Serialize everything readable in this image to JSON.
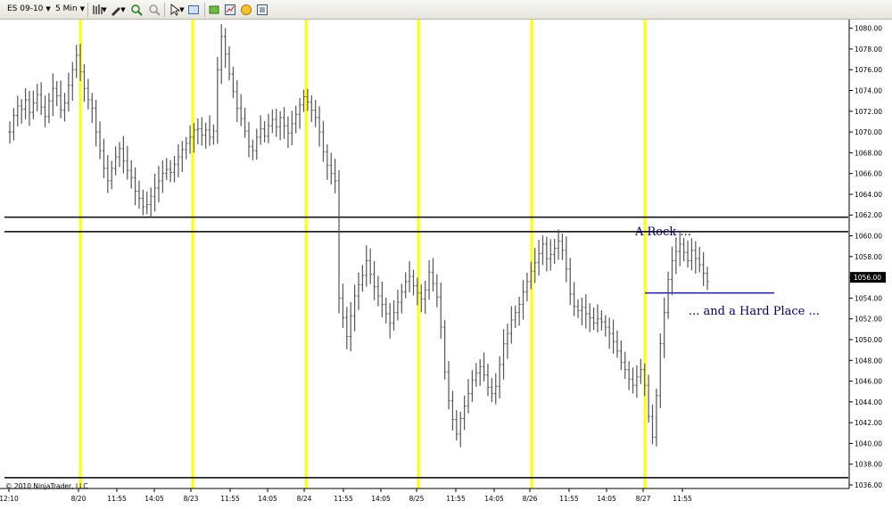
{
  "toolbar": {
    "instrument": "ES 09-10",
    "interval": "5 Min"
  },
  "copyright": "© 2010 NinjaTrader, LLC",
  "colors": {
    "price": "#555555",
    "session_divider": "#ffff00",
    "level_line": "#000000",
    "support_line": "#1a1aa0",
    "annotation": "#000060"
  },
  "chart_data": {
    "type": "bar",
    "subtype": "ohlc-price-bars",
    "instrument": "ES 09-10",
    "interval": "5 Min",
    "ylim": [
      1036,
      1081
    ],
    "y_ticks": [
      1036,
      1038,
      1040,
      1042,
      1044,
      1046,
      1048,
      1050,
      1052,
      1054,
      1056,
      1058,
      1060,
      1062,
      1064,
      1066,
      1068,
      1070,
      1072,
      1074,
      1076,
      1078,
      1080
    ],
    "y_tick_labels": [
      "1036.00",
      "1038.00",
      "1040.00",
      "1042.00",
      "1044.00",
      "1046.00",
      "1048.00",
      "1050.00",
      "1052.00",
      "1054.00",
      "1056.00",
      "1058.00",
      "1060.00",
      "1062.00",
      "1064.00",
      "1066.00",
      "1068.00",
      "1070.00",
      "1072.00",
      "1074.00",
      "1076.00",
      "1078.00",
      "1080.00"
    ],
    "x_tick_labels": [
      "12:10",
      "8/20",
      "11:55",
      "14:05",
      "8/23",
      "11:55",
      "14:05",
      "8/24",
      "11:55",
      "14:05",
      "8/25",
      "11:55",
      "14:05",
      "8/26",
      "11:55",
      "14:05",
      "8/27",
      "11:55"
    ],
    "sessions": [
      "8/20",
      "8/23",
      "8/24",
      "8/25",
      "8/26",
      "8/27"
    ],
    "current_price": "1056.00",
    "horizontal_levels": [
      {
        "value": 1061.8,
        "color": "black"
      },
      {
        "value": 1060.4,
        "color": "black"
      },
      {
        "value": 1036.7,
        "color": "black"
      },
      {
        "value": 1054.5,
        "color": "blue",
        "start": "8/27"
      }
    ],
    "annotations": [
      "A Rock ...",
      "... and a Hard Place ..."
    ],
    "series": [
      {
        "values": [
          1070,
          1071.6,
          1072.5,
          1072.2,
          1073.1,
          1071.9,
          1072.8,
          1073.6,
          1072.4,
          1071.5,
          1073,
          1074.2,
          1073.5,
          1072.1,
          1072.8,
          1074.5,
          1076,
          1077.4,
          1075.8,
          1074.2,
          1073.1,
          1072.3,
          1070,
          1068.2,
          1066.5,
          1065.3,
          1066.5,
          1067.6,
          1068.4,
          1067.2,
          1066.3,
          1065.6,
          1064.3,
          1063.6,
          1062.8,
          1063,
          1063.8,
          1064.6,
          1065.3,
          1066,
          1066.4,
          1066.1,
          1066.9,
          1067.6,
          1068.3,
          1068.9,
          1069.5,
          1070.2,
          1070.3,
          1069.7,
          1070.2,
          1069.5,
          1070.1,
          1076,
          1079.2,
          1077.5,
          1075.6,
          1073.9,
          1072.3,
          1071.3,
          1070.1,
          1068.6,
          1068.2,
          1069.5,
          1070.3,
          1069.6,
          1070.6,
          1071.2,
          1070.5,
          1071.4,
          1070.6,
          1069.9,
          1070.8,
          1071.7,
          1072.6,
          1073.4,
          1072.9,
          1072.1,
          1071.4,
          1070,
          1068.1,
          1066.8,
          1066,
          1065.3,
          1054,
          1052.1,
          1050.3,
          1052.3,
          1054.2,
          1055.3,
          1056.2,
          1057.6,
          1056.3,
          1055.1,
          1054.2,
          1053.4,
          1052.5,
          1051.6,
          1052.6,
          1053.6,
          1054.6,
          1055.6,
          1056.1,
          1055.2,
          1054.5,
          1053.9,
          1054.8,
          1056.5,
          1055.4,
          1054.1,
          1051.2,
          1046.9,
          1044.1,
          1042.3,
          1040.9,
          1042.4,
          1043.6,
          1044.8,
          1046.1,
          1046.8,
          1047.4,
          1046.6,
          1045.4,
          1044.8,
          1045.5,
          1047.6,
          1049.6,
          1050.6,
          1051.9,
          1052.6,
          1053.4,
          1054.6,
          1055.6,
          1056.6,
          1057.4,
          1058.3,
          1059.2,
          1057.8,
          1058.2,
          1058.8,
          1059.5,
          1058.6,
          1056.8,
          1054.4,
          1053.2,
          1052.8,
          1053.1,
          1052.5,
          1052.1,
          1051.6,
          1052,
          1051.7,
          1051.2,
          1050.6,
          1049.8,
          1048.9,
          1047.8,
          1047.1,
          1046.2,
          1045.6,
          1046.4,
          1047.1,
          1045.6,
          1042.6,
          1040.6,
          1044.6,
          1049.6,
          1052.6,
          1055.8,
          1057.6,
          1058.5,
          1059.2,
          1058.4,
          1057.6,
          1058.6,
          1057.8,
          1057.2,
          1056.4,
          1055.6
        ]
      }
    ]
  }
}
